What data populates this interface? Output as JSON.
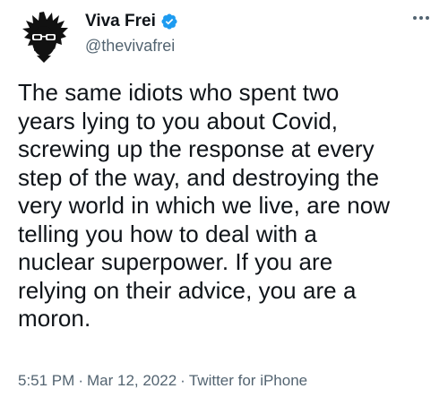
{
  "author": {
    "display_name": "Viva Frei",
    "handle": "@thevivafrei",
    "verified_icon": "verified-badge-icon",
    "avatar_icon": "spiky-hair-sunglasses-avatar"
  },
  "more_icon": "more-horizontal-icon",
  "tweet": {
    "text": "The same idiots who spent two\nyears lying to you about Covid,\nscrewing up the response at every\nstep of the way, and destroying the\nvery world in which we live, are now\ntelling you how to deal with a\nnuclear superpower. If you are\nrelying on their advice, you are a\nmoron.",
    "time": "5:51 PM",
    "separator": "·",
    "date": "Mar 12, 2022",
    "source": "Twitter for iPhone"
  },
  "colors": {
    "text": "#0f1419",
    "secondary": "#536471",
    "verified_blue": "#1d9bf0",
    "background": "#ffffff"
  }
}
